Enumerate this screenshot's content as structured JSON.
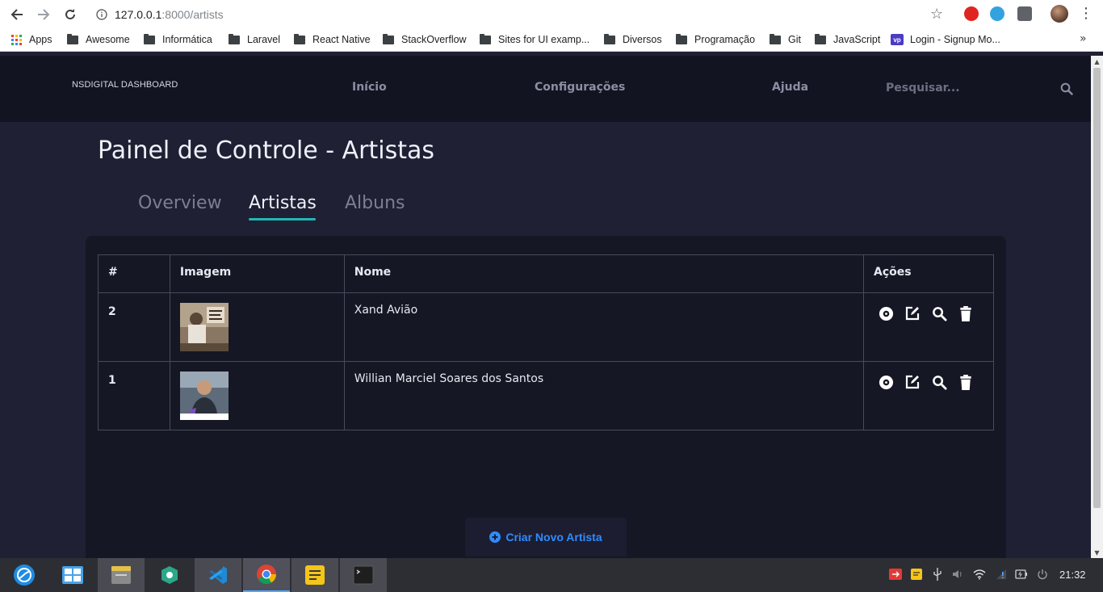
{
  "browser": {
    "url_host": "127.0.0.1",
    "url_path": ":8000/artists",
    "bookmarks": [
      {
        "label": "Apps",
        "type": "apps"
      },
      {
        "label": "Awesome",
        "type": "folder"
      },
      {
        "label": "Informática",
        "type": "folder"
      },
      {
        "label": "Laravel",
        "type": "folder"
      },
      {
        "label": "React Native",
        "type": "folder"
      },
      {
        "label": "StackOverflow",
        "type": "folder"
      },
      {
        "label": "Sites for UI examp...",
        "type": "folder"
      },
      {
        "label": "Diversos",
        "type": "folder"
      },
      {
        "label": "Programação",
        "type": "folder"
      },
      {
        "label": "Git",
        "type": "folder"
      },
      {
        "label": "JavaScript",
        "type": "folder"
      },
      {
        "label": "Login - Signup Mo...",
        "type": "page"
      }
    ],
    "bookmark_more": "»"
  },
  "site": {
    "brand": "NSDIGITAL DASHBOARD",
    "nav": [
      "Início",
      "Configurações",
      "Ajuda"
    ],
    "search_placeholder": "Pesquisar..."
  },
  "page": {
    "title": "Painel de Controle - Artistas",
    "tabs": [
      {
        "label": "Overview",
        "active": false
      },
      {
        "label": "Artistas",
        "active": true
      },
      {
        "label": "Albuns",
        "active": false
      }
    ]
  },
  "table": {
    "headers": [
      "#",
      "Imagem",
      "Nome",
      "Ações"
    ],
    "rows": [
      {
        "id": "2",
        "name": "Xand Avião",
        "image": "album-cover"
      },
      {
        "id": "1",
        "name": "Willian Marciel Soares dos Santos",
        "image": "profile-photo"
      }
    ],
    "action_icons": [
      "view-icon",
      "edit-icon",
      "search-icon",
      "trash-icon"
    ]
  },
  "create_button": {
    "label": "Criar Novo Artista",
    "color": "#2f8bff"
  },
  "colors": {
    "accent": "#22b7b5",
    "background": "#1f2033",
    "navbar": "#131421",
    "panel": "#161724"
  },
  "taskbar": {
    "apps": [
      "deepin-launcher-icon",
      "multitask-view-icon",
      "file-manager-icon",
      "app-store-icon",
      "vscode-icon",
      "chrome-icon",
      "notes-icon",
      "terminal-icon"
    ],
    "clock": "21:32"
  }
}
